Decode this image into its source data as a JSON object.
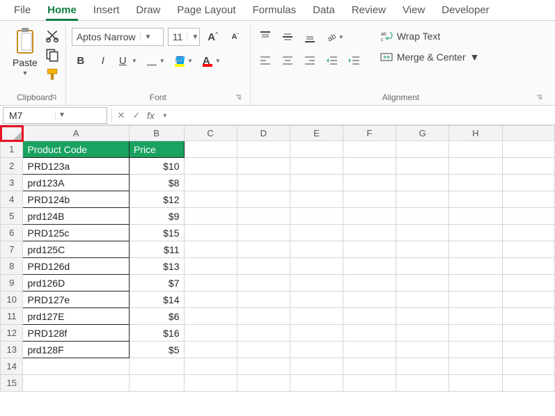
{
  "tabs": [
    "File",
    "Home",
    "Insert",
    "Draw",
    "Page Layout",
    "Formulas",
    "Data",
    "Review",
    "View",
    "Developer"
  ],
  "active_tab": 1,
  "clipboard": {
    "paste": "Paste",
    "label": "Clipboard"
  },
  "font": {
    "name": "Aptos Narrow",
    "size": "11",
    "label": "Font"
  },
  "alignment": {
    "wrap": "Wrap Text",
    "merge": "Merge & Center",
    "label": "Alignment"
  },
  "namebox": "M7",
  "formula": "",
  "columns": [
    "A",
    "B",
    "C",
    "D",
    "E",
    "F",
    "G",
    "H"
  ],
  "header_row": {
    "a": "Product Code",
    "b": "Price"
  },
  "rows": [
    {
      "n": 2,
      "code": "PRD123a",
      "price": "$10"
    },
    {
      "n": 3,
      "code": "prd123A",
      "price": "$8"
    },
    {
      "n": 4,
      "code": "PRD124b",
      "price": "$12"
    },
    {
      "n": 5,
      "code": "prd124B",
      "price": "$9"
    },
    {
      "n": 6,
      "code": "PRD125c",
      "price": "$15"
    },
    {
      "n": 7,
      "code": "prd125C",
      "price": "$11"
    },
    {
      "n": 8,
      "code": "PRD126d",
      "price": "$13"
    },
    {
      "n": 9,
      "code": "prd126D",
      "price": "$7"
    },
    {
      "n": 10,
      "code": "PRD127e",
      "price": "$14"
    },
    {
      "n": 11,
      "code": "prd127E",
      "price": "$6"
    },
    {
      "n": 12,
      "code": "PRD128f",
      "price": "$16"
    },
    {
      "n": 13,
      "code": "prd128F",
      "price": "$5"
    }
  ],
  "empty_rows": [
    14,
    15
  ]
}
